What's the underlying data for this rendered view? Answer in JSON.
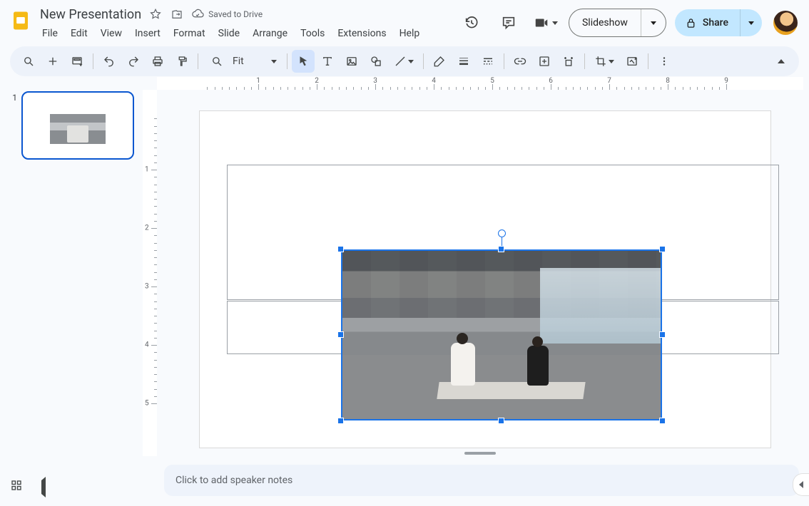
{
  "doc": {
    "title": "New Presentation",
    "save_status": "Saved to Drive"
  },
  "menu": {
    "file": "File",
    "edit": "Edit",
    "view": "View",
    "insert": "Insert",
    "format": "Format",
    "slide": "Slide",
    "arrange": "Arrange",
    "tools": "Tools",
    "extensions": "Extensions",
    "help": "Help"
  },
  "header": {
    "slideshow": "Slideshow",
    "share": "Share"
  },
  "toolbar": {
    "zoom_label": "Fit"
  },
  "ruler": {
    "h_labels": [
      "1",
      "2",
      "3",
      "4",
      "5",
      "6",
      "7",
      "8",
      "9"
    ],
    "v_labels": [
      "1",
      "2",
      "3",
      "4",
      "5"
    ]
  },
  "thumbnails": {
    "items": [
      {
        "num": "1"
      }
    ]
  },
  "notes": {
    "placeholder": "Click to add speaker notes"
  }
}
